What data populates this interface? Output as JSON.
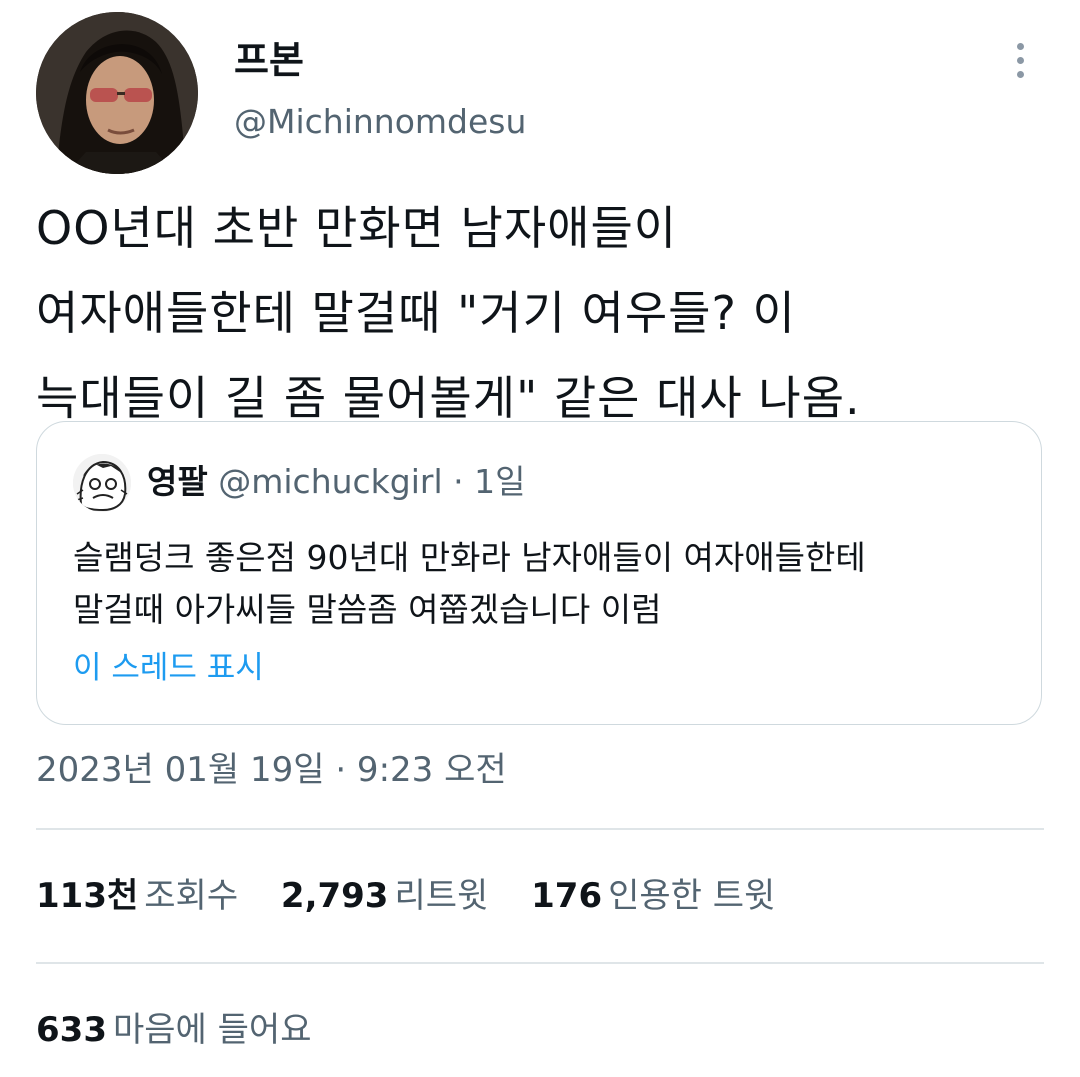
{
  "author": {
    "name": "프본",
    "handle": "@Michinnomdesu"
  },
  "tweet": {
    "text": "OO년대 초반 만화면 남자애들이\n여자애들한테 말걸때 \"거기 여우들? 이\n늑대들이 길 좀 물어볼게\" 같은 대사 나옴."
  },
  "quote": {
    "name": "영팔",
    "handle": "@michuckgirl",
    "separator": "·",
    "time": "1일",
    "text": "슬램덩크 좋은점 90년대 만화라 남자애들이 여자애들한테\n말걸때 아가씨들 말씀좀 여쭙겠습니다 이럼",
    "show_thread": "이 스레드 표시"
  },
  "timestamp": "2023년 01월 19일 · 9:23 오전",
  "stats": {
    "views": {
      "count": "113천",
      "label": "조회수"
    },
    "retweets": {
      "count": "2,793",
      "label": "리트윗"
    },
    "quotes": {
      "count": "176",
      "label": "인용한 트윗"
    },
    "likes": {
      "count": "633",
      "label": "마음에 들어요"
    }
  },
  "icons": {
    "more": "more-vertical-icon"
  },
  "colors": {
    "text_primary": "#0f1419",
    "text_secondary": "#536471",
    "link": "#1d9bf0",
    "border": "#cfd9de"
  }
}
